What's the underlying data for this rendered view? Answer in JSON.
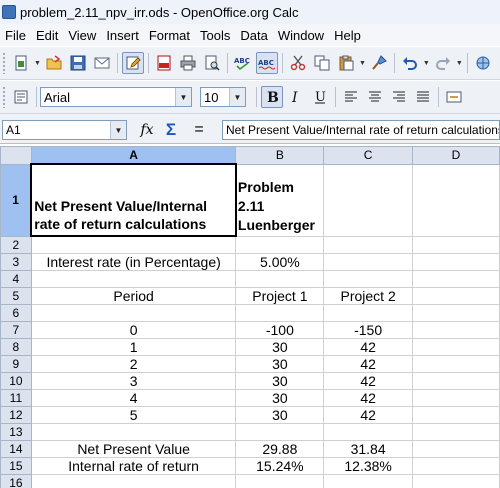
{
  "window": {
    "title": "problem_2.11_npv_irr.ods - OpenOffice.org Calc"
  },
  "menu": [
    "File",
    "Edit",
    "View",
    "Insert",
    "Format",
    "Tools",
    "Data",
    "Window",
    "Help"
  ],
  "format_bar": {
    "font_name": "Arial",
    "font_size": "10"
  },
  "formula_bar": {
    "cell_ref": "A1",
    "content": "Net Present Value/Internal rate of return calculations",
    "fx": "fx",
    "sum": "Σ",
    "equals": "="
  },
  "sheet": {
    "columns": [
      "A",
      "B",
      "C",
      "D"
    ],
    "rows": [
      "1",
      "2",
      "3",
      "4",
      "5",
      "6",
      "7",
      "8",
      "9",
      "10",
      "11",
      "12",
      "13",
      "14",
      "15",
      "16"
    ],
    "cells": {
      "A1": "Net Present Value/Internal rate of return calculations",
      "B1": "Problem 2.11 Luenberger",
      "A3": "Interest rate (in Percentage)",
      "B3": "5.00%",
      "A5": "Period",
      "B5": "Project 1",
      "C5": "Project 2",
      "A7": "0",
      "B7": "-100",
      "C7": "-150",
      "A8": "1",
      "B8": "30",
      "C8": "42",
      "A9": "2",
      "B9": "30",
      "C9": "42",
      "A10": "3",
      "B10": "30",
      "C10": "42",
      "A11": "4",
      "B11": "30",
      "C11": "42",
      "A12": "5",
      "B12": "30",
      "C12": "42",
      "A14": "Net Present Value",
      "B14": "29.88",
      "C14": "31.84",
      "A15": "Internal rate of return",
      "B15": "15.24%",
      "C15": "12.38%"
    }
  }
}
